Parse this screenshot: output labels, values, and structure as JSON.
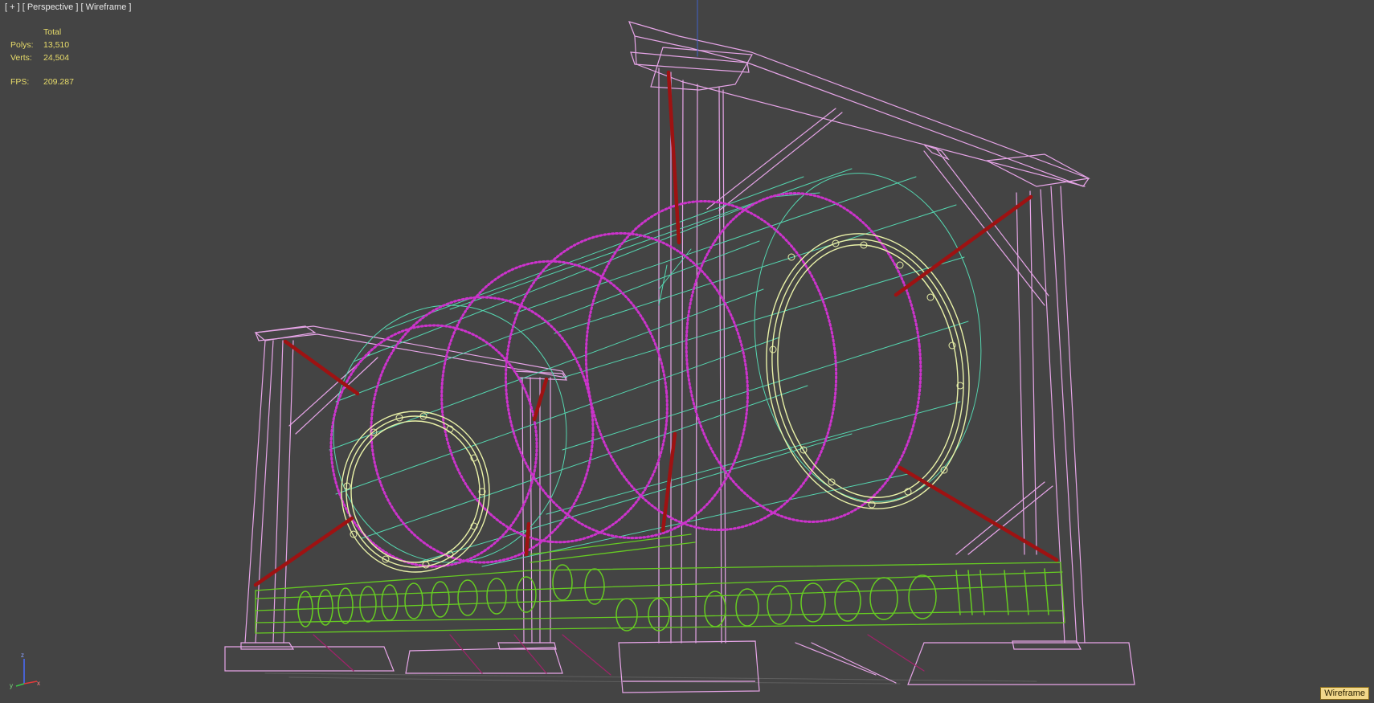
{
  "viewport": {
    "header": {
      "plus_menu": "[ + ]",
      "view_menu": "[ Perspective ]",
      "shading_menu": "[ Wireframe ]"
    },
    "stats": {
      "column_header": "Total",
      "polys_label": "Polys:",
      "polys_value": "13,510",
      "verts_label": "Verts:",
      "verts_value": "24,504",
      "fps_label": "FPS:",
      "fps_value": "209.287"
    },
    "mode_badge": "Wireframe",
    "axis_labels": {
      "x": "x",
      "y": "y",
      "z": "z"
    }
  },
  "colors": {
    "background": "#444444",
    "frame_pink": "#e7a5e8",
    "cylinder_magenta": "#cc33cc",
    "mesh_cyan": "#55d6b0",
    "ring_yellow": "#eaf2a8",
    "base_green": "#66cc22",
    "strut_red": "#9e1212",
    "stats_text": "#e8dc6a"
  }
}
